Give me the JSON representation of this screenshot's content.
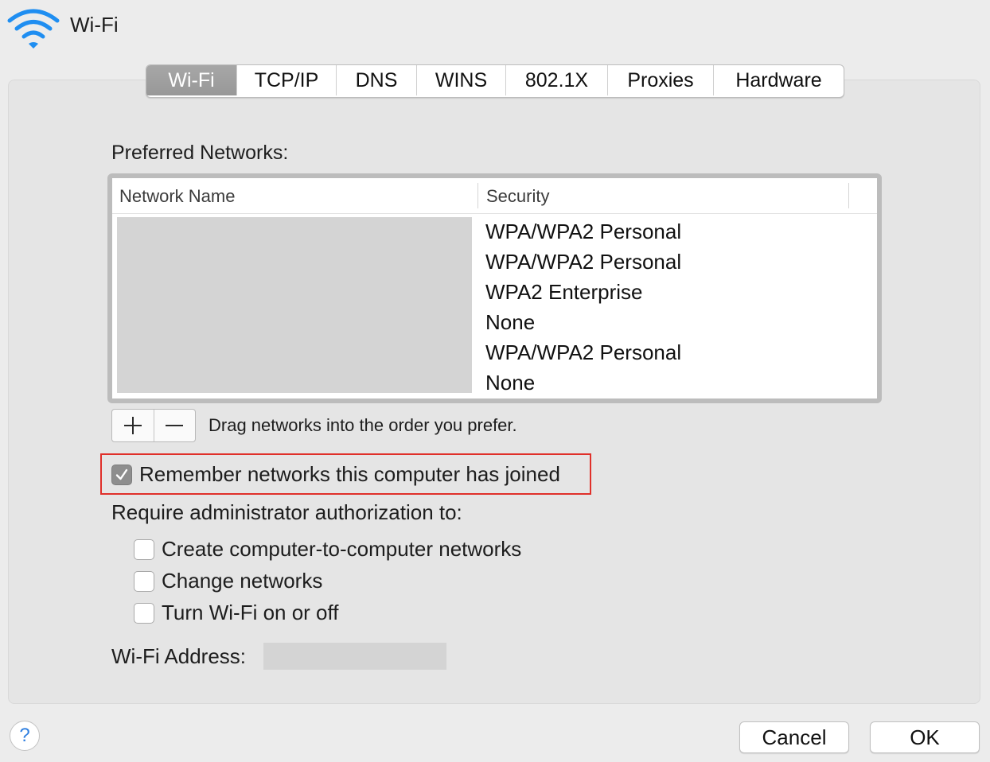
{
  "header": {
    "title": "Wi-Fi",
    "icon": "wifi-icon",
    "icon_color": "#1f8ef1"
  },
  "tabs": [
    {
      "label": "Wi-Fi",
      "active": true
    },
    {
      "label": "TCP/IP",
      "active": false
    },
    {
      "label": "DNS",
      "active": false
    },
    {
      "label": "WINS",
      "active": false
    },
    {
      "label": "802.1X",
      "active": false
    },
    {
      "label": "Proxies",
      "active": false
    },
    {
      "label": "Hardware",
      "active": false
    }
  ],
  "preferred_networks": {
    "label": "Preferred Networks:",
    "columns": [
      "Network Name",
      "Security"
    ],
    "rows": [
      {
        "security": "WPA/WPA2 Personal"
      },
      {
        "security": "WPA/WPA2 Personal"
      },
      {
        "security": "WPA2 Enterprise"
      },
      {
        "security": "None"
      },
      {
        "security": "WPA/WPA2 Personal"
      },
      {
        "security": "None"
      }
    ],
    "add_icon": "plus-icon",
    "remove_icon": "minus-icon",
    "hint": "Drag networks into the order you prefer."
  },
  "options": {
    "remember": {
      "label": "Remember networks this computer has joined",
      "checked": true
    },
    "require_label": "Require administrator authorization to:",
    "require_items": [
      {
        "label": "Create computer-to-computer networks",
        "checked": false
      },
      {
        "label": "Change networks",
        "checked": false
      },
      {
        "label": "Turn Wi-Fi on or off",
        "checked": false
      }
    ]
  },
  "address": {
    "label": "Wi-Fi Address:"
  },
  "footer": {
    "help": "?",
    "cancel": "Cancel",
    "ok": "OK"
  },
  "colors": {
    "highlight": "#e0302a",
    "active_tab": "#9e9e9e"
  }
}
